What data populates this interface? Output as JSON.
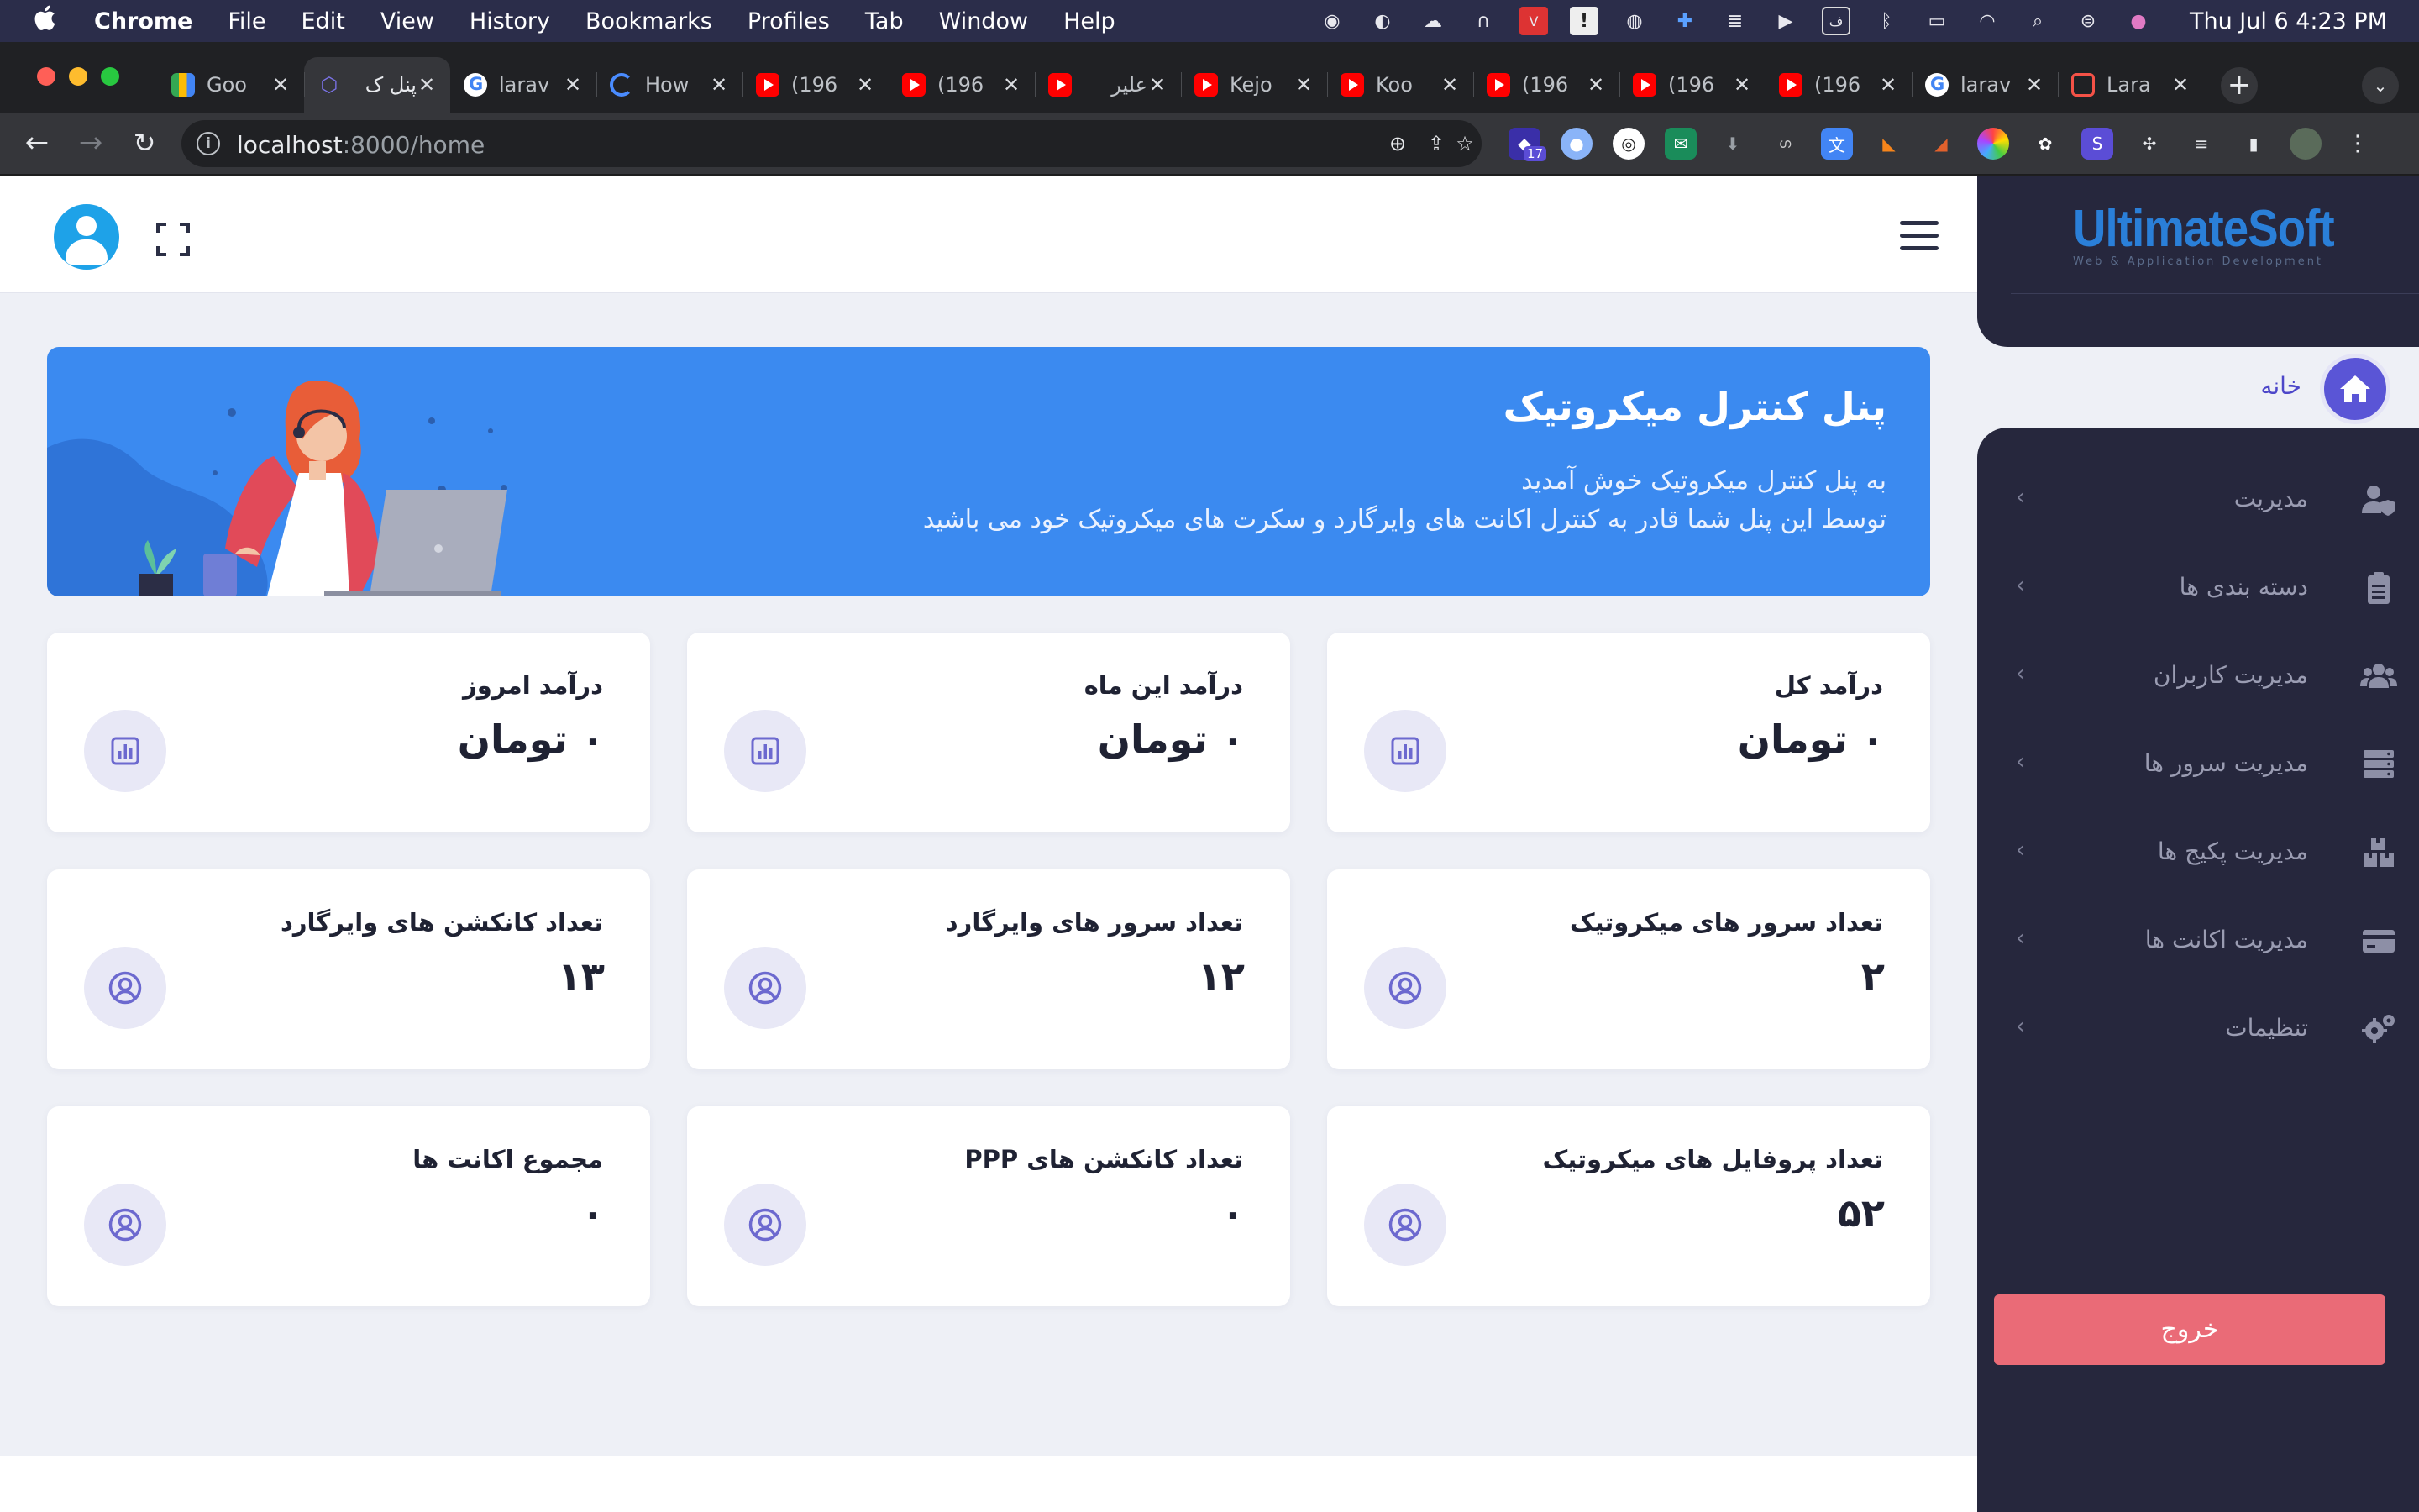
{
  "menubar": {
    "app": "Chrome",
    "items": [
      "File",
      "Edit",
      "View",
      "History",
      "Bookmarks",
      "Profiles",
      "Tab",
      "Window",
      "Help"
    ],
    "clock": "Thu Jul 6  4:23 PM"
  },
  "tabs": [
    {
      "title": "Goo",
      "favicon": "google-meet"
    },
    {
      "title": "پنل ک",
      "favicon": "app-icon",
      "active": true
    },
    {
      "title": "larav",
      "favicon": "google"
    },
    {
      "title": "How",
      "favicon": "loading"
    },
    {
      "title": "(196",
      "favicon": "youtube"
    },
    {
      "title": "(196",
      "favicon": "youtube"
    },
    {
      "title": "علیر",
      "favicon": "youtube"
    },
    {
      "title": "Kejo",
      "favicon": "youtube"
    },
    {
      "title": "Koo",
      "favicon": "youtube"
    },
    {
      "title": "(196",
      "favicon": "youtube"
    },
    {
      "title": "(196",
      "favicon": "youtube"
    },
    {
      "title": "(196",
      "favicon": "youtube"
    },
    {
      "title": "larav",
      "favicon": "google"
    },
    {
      "title": "Lara",
      "favicon": "laravel"
    }
  ],
  "toolbar": {
    "url_host": "localhost",
    "url_path": ":8000/home",
    "extension_badge": "17"
  },
  "sidebar": {
    "logo_main": "UltimateSoft",
    "logo_sub": "Web & Application Development",
    "home_label": "خانه",
    "menu": [
      {
        "label": "مدیریت",
        "icon": "user-shield-icon"
      },
      {
        "label": "دسته بندی ها",
        "icon": "clipboard-icon"
      },
      {
        "label": "مدیریت کاربران",
        "icon": "users-icon"
      },
      {
        "label": "مدیریت سرور ها",
        "icon": "server-icon"
      },
      {
        "label": "مدیریت پکیج ها",
        "icon": "boxes-icon"
      },
      {
        "label": "مدیریت اکانت ها",
        "icon": "credit-card-icon"
      },
      {
        "label": "تنظیمات",
        "icon": "cogs-icon"
      }
    ],
    "logout_label": "خروج"
  },
  "hero": {
    "title": "پنل کنترل میکروتیک",
    "line1": "به پنل کنترل میکروتیک خوش آمدید",
    "line2": "توسط این پنل شما قادر به کنترل اکانت های وایرگارد و سکرت های میکروتیک خود می باشید"
  },
  "cards": [
    {
      "title": "درآمد کل",
      "value": "۰ تومان",
      "icon": "chart-icon"
    },
    {
      "title": "درآمد این ماه",
      "value": "۰ تومان",
      "icon": "chart-icon"
    },
    {
      "title": "درآمد امروز",
      "value": "۰ تومان",
      "icon": "chart-icon"
    },
    {
      "title": "تعداد سرور های میکروتیک",
      "value": "۲",
      "icon": "user-circle-icon"
    },
    {
      "title": "تعداد سرور های وایرگارد",
      "value": "۱۲",
      "icon": "user-circle-icon"
    },
    {
      "title": "تعداد کانکشن های وایرگارد",
      "value": "۱۳",
      "icon": "user-circle-icon"
    },
    {
      "title": "تعداد پروفایل های میکروتیک",
      "value": "۵۲",
      "icon": "user-circle-icon"
    },
    {
      "title": "تعداد کانکشن های PPP",
      "value": "۰",
      "icon": "user-circle-icon"
    },
    {
      "title": "مجموع اکانت ها",
      "value": "۰",
      "icon": "user-circle-icon"
    }
  ],
  "colors": {
    "sidebar_bg": "#26273d",
    "accent": "#5a55d6",
    "hero_bg": "#3b8af0",
    "logout": "#ea6b77",
    "page_bg": "#eef0f6"
  }
}
